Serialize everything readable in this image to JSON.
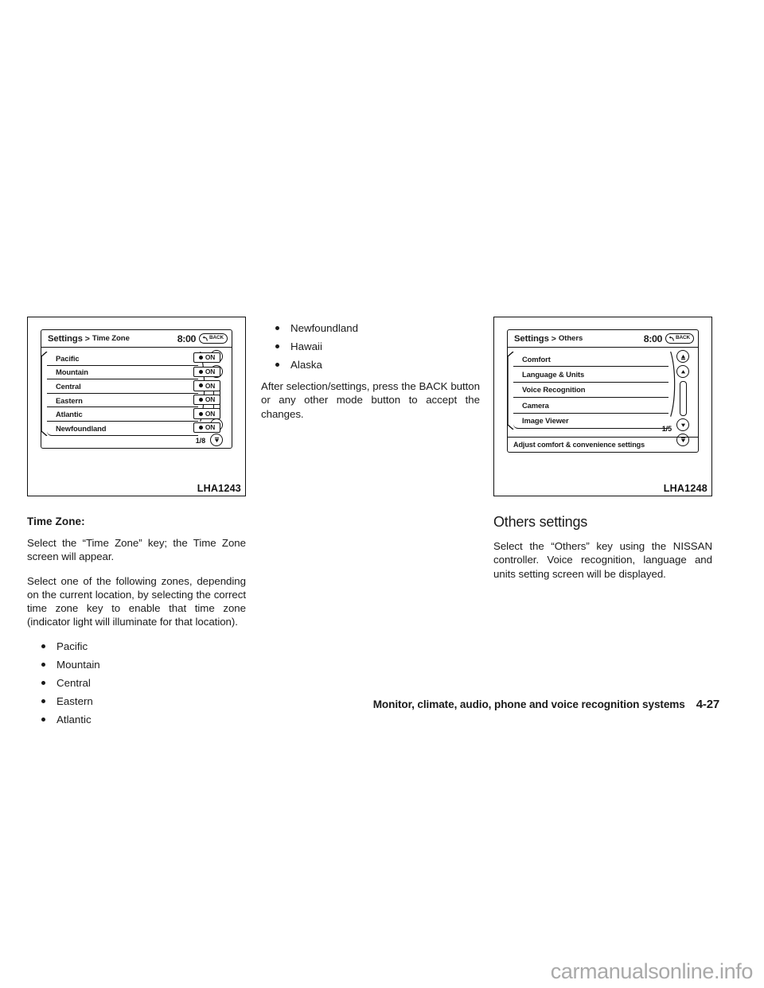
{
  "figure_left": {
    "caption": "LHA1243",
    "screen": {
      "title_main": "Settings",
      "title_separator": ">",
      "title_sub": "Time Zone",
      "clock": "8:00",
      "back_label": "BACK",
      "page_indicator": "1/8",
      "rows": [
        {
          "label": "Pacific",
          "toggle": "ON"
        },
        {
          "label": "Mountain",
          "toggle": "ON"
        },
        {
          "label": "Central",
          "toggle": "ON"
        },
        {
          "label": "Eastern",
          "toggle": "ON"
        },
        {
          "label": "Atlantic",
          "toggle": "ON"
        },
        {
          "label": "Newfoundland",
          "toggle": "ON"
        }
      ]
    }
  },
  "figure_right": {
    "caption": "LHA1248",
    "screen": {
      "title_main": "Settings",
      "title_separator": ">",
      "title_sub": "Others",
      "clock": "8:00",
      "back_label": "BACK",
      "page_indicator": "1/5",
      "rows": [
        {
          "label": "Comfort"
        },
        {
          "label": "Language & Units"
        },
        {
          "label": "Voice Recognition"
        },
        {
          "label": "Camera"
        },
        {
          "label": "Image Viewer"
        }
      ],
      "status_bar": "Adjust comfort & convenience settings"
    }
  },
  "column_left": {
    "heading": "Time Zone:",
    "paragraph_1": "Select the “Time Zone” key; the Time Zone screen will appear.",
    "paragraph_2": "Select one of the following zones, depending on the current location, by selecting the correct time zone key to enable that time zone (indicator light will illuminate for that location).",
    "bullets": [
      "Pacific",
      "Mountain",
      "Central",
      "Eastern",
      "Atlantic"
    ]
  },
  "column_mid": {
    "bullets": [
      "Newfoundland",
      "Hawaii",
      "Alaska"
    ],
    "paragraph_1": "After selection/settings, press the BACK button or any other mode button to accept the changes."
  },
  "column_right": {
    "heading": "Others settings",
    "paragraph_1": "Select the “Others” key using the NISSAN controller. Voice recognition, language and units setting screen will be displayed."
  },
  "footer": {
    "title": "Monitor, climate, audio, phone and voice recognition systems",
    "page": "4-27"
  },
  "watermark": "carmanualsonline.info",
  "icons": {
    "back_arrow": "back-arrow-icon",
    "scroll_top": "scroll-to-top-icon",
    "scroll_up": "scroll-up-icon",
    "scroll_down": "scroll-down-icon",
    "scroll_bottom": "scroll-to-bottom-icon"
  }
}
